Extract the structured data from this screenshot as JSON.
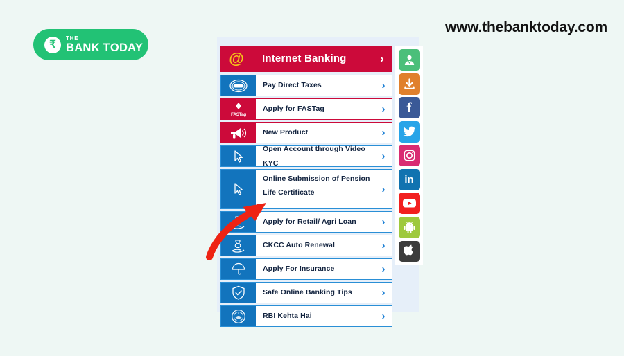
{
  "brand": {
    "logo_small_text": "THE",
    "logo_name": "BANK TODAY",
    "logo_currency_symbol": "₹",
    "logo_color": "#22c275",
    "site_url": "www.thebanktoday.com"
  },
  "panel": {
    "background_color": "#e6eff9",
    "header": {
      "label": "Internet Banking",
      "icon": "at-symbol-icon",
      "chevron": "›",
      "background_color": "#cc0a3a",
      "icon_color": "#f5c518"
    },
    "items": [
      {
        "label": "Pay Direct Taxes",
        "icon": "tax-emblem-icon",
        "color": "#1274bd",
        "chevron": "›"
      },
      {
        "label": "Apply for FASTag",
        "icon": "fastag-logo-icon",
        "color": "#cc0a3a",
        "chevron": "›"
      },
      {
        "label": "New Product",
        "icon": "megaphone-icon",
        "color": "#cc0a3a",
        "chevron": "›"
      },
      {
        "label": "Open Account through Video KYC",
        "icon": "cursor-arrow-icon",
        "color": "#1274bd",
        "chevron": "›"
      },
      {
        "label": "Online Submission of Pension Life Certificate",
        "icon": "cursor-arrow-icon",
        "color": "#1274bd",
        "chevron": "›"
      },
      {
        "label": "Apply for Retail/ Agri Loan",
        "icon": "hand-money-icon",
        "color": "#1274bd",
        "chevron": "›"
      },
      {
        "label": "CKCC Auto Renewal",
        "icon": "hand-money-icon",
        "color": "#1274bd",
        "chevron": "›"
      },
      {
        "label": "Apply For Insurance",
        "icon": "umbrella-icon",
        "color": "#1274bd",
        "chevron": "›"
      },
      {
        "label": "Safe Online Banking Tips",
        "icon": "shield-check-icon",
        "color": "#1274bd",
        "chevron": "›"
      },
      {
        "label": "RBI Kehta Hai",
        "icon": "rbi-emblem-icon",
        "color": "#1274bd",
        "chevron": "›"
      }
    ]
  },
  "social": {
    "items": [
      {
        "name": "customer-portal-icon",
        "color": "#4bbf7a"
      },
      {
        "name": "download-icon",
        "color": "#e0802c"
      },
      {
        "name": "facebook-icon",
        "color": "#3a5997",
        "glyph": "f"
      },
      {
        "name": "twitter-icon",
        "color": "#28a4e8"
      },
      {
        "name": "instagram-icon",
        "color": "#d92b72"
      },
      {
        "name": "linkedin-icon",
        "color": "#1173b0",
        "glyph": "in"
      },
      {
        "name": "youtube-icon",
        "color": "#f21f1f"
      },
      {
        "name": "android-icon",
        "color": "#9ec93d"
      },
      {
        "name": "apple-icon",
        "color": "#3c3c3c"
      }
    ]
  },
  "annotation": {
    "type": "red-arrow",
    "color": "#ee2313",
    "points_to": "Apply for Retail/ Agri Loan"
  }
}
